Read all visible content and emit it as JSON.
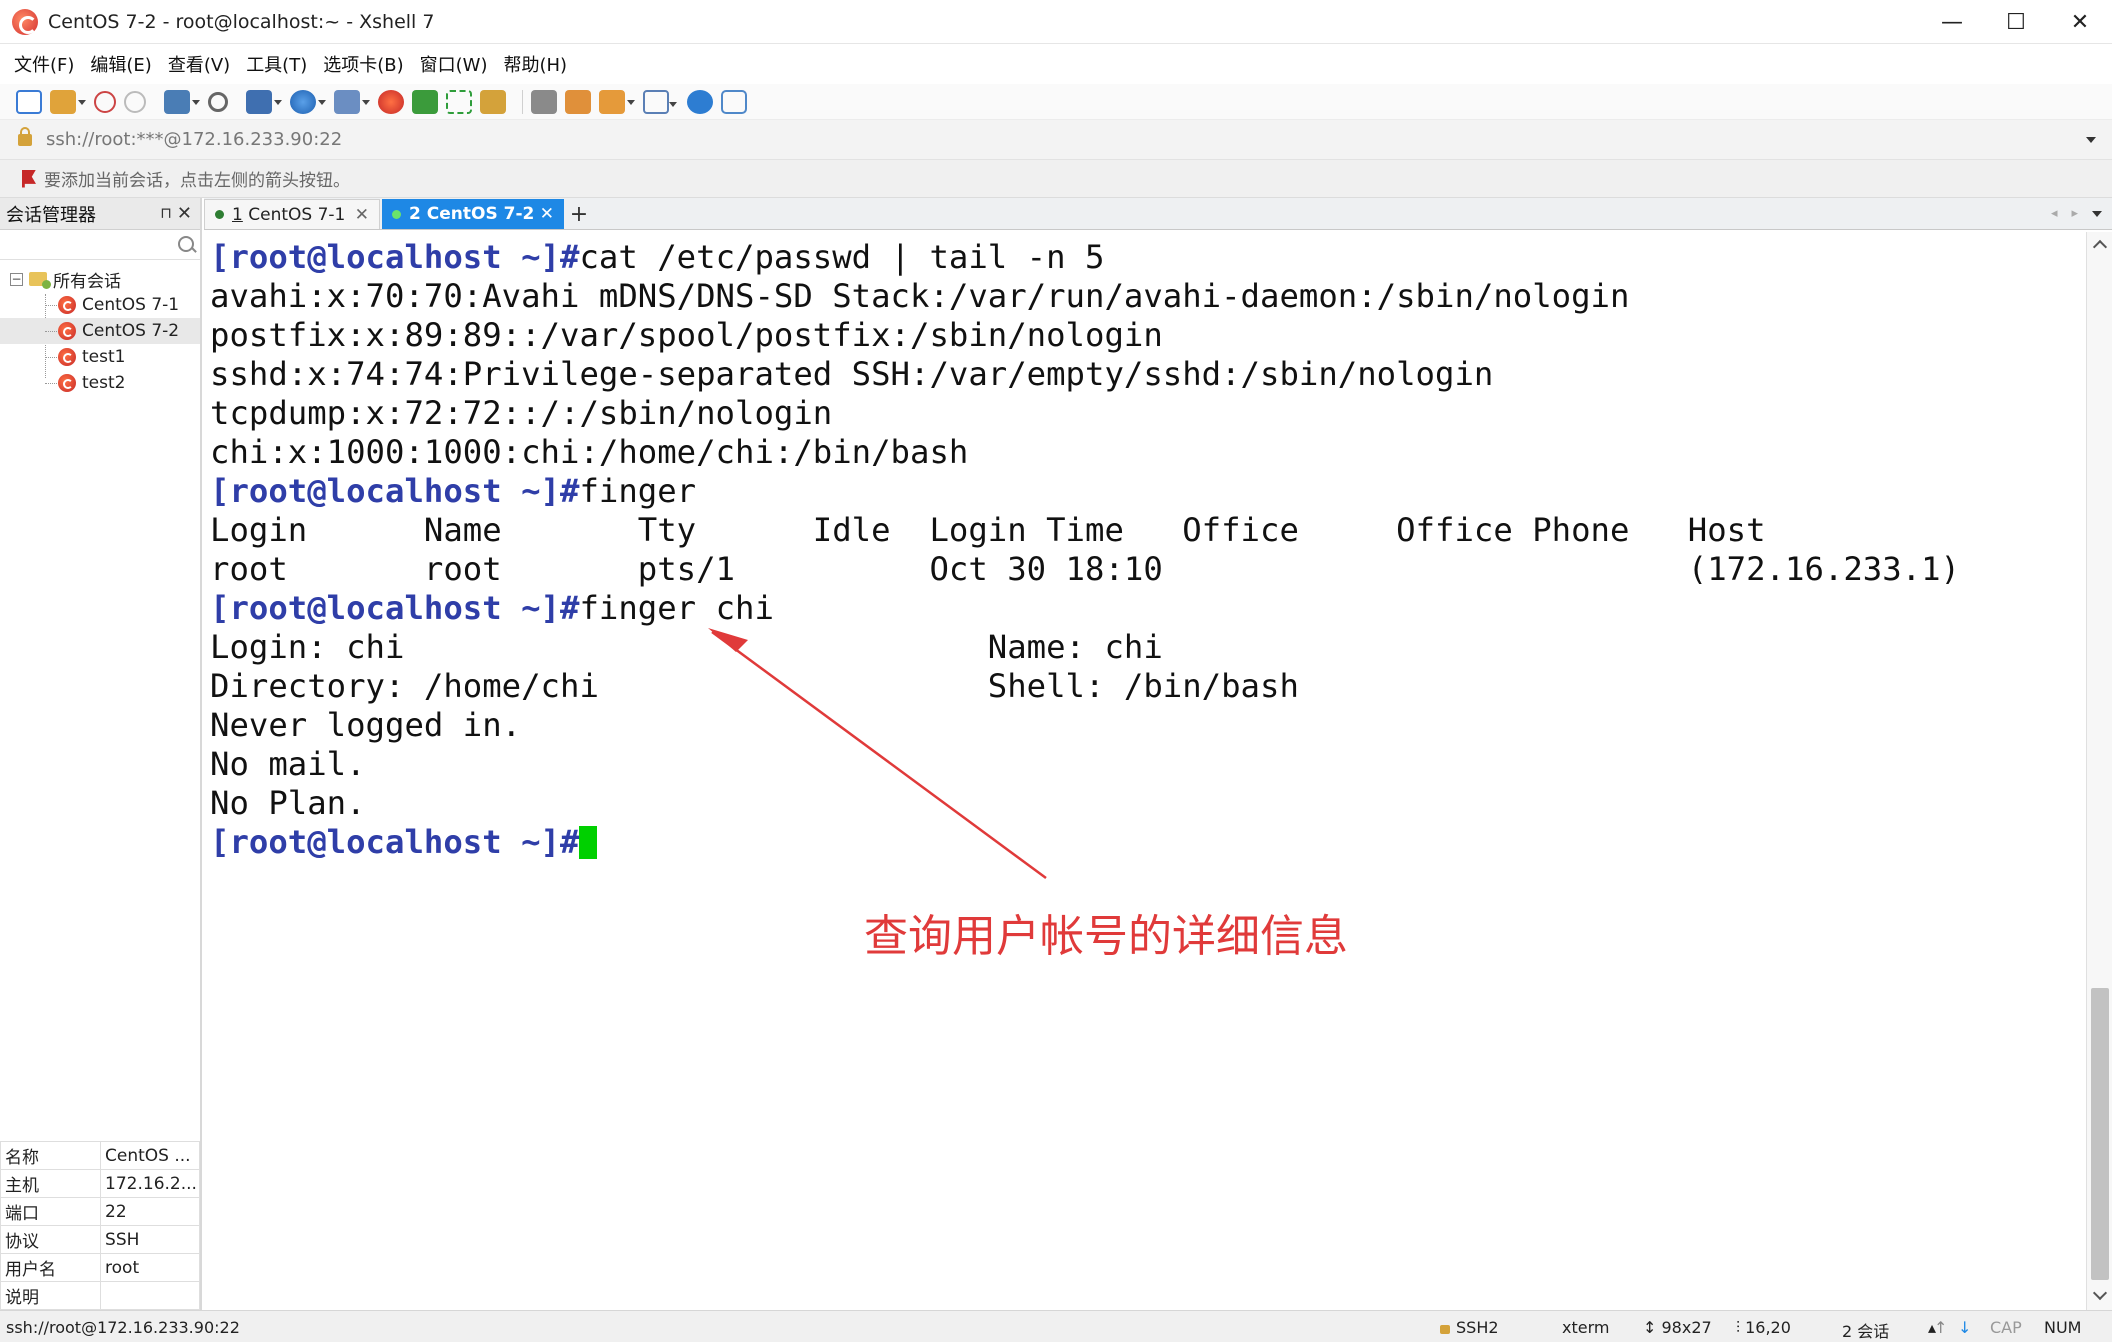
{
  "window": {
    "title": "CentOS 7-2 - root@localhost:~ - Xshell 7",
    "minimize": "—",
    "maximize": "☐",
    "close": "✕"
  },
  "menu": [
    "文件(F)",
    "编辑(E)",
    "查看(V)",
    "工具(T)",
    "选项卡(B)",
    "窗口(W)",
    "帮助(H)"
  ],
  "address": {
    "value": "ssh://root:***@172.16.233.90:22"
  },
  "hint": {
    "text": "要添加当前会话，点击左侧的箭头按钮。"
  },
  "sidebar": {
    "title": "会话管理器",
    "pin": "⊓",
    "close": "✕",
    "search_placeholder": "",
    "tree": {
      "root": "所有会话",
      "expander": "−",
      "items": [
        "CentOS 7-1",
        "CentOS 7-2",
        "test1",
        "test2"
      ]
    },
    "properties": [
      {
        "key": "名称",
        "value": "CentOS ..."
      },
      {
        "key": "主机",
        "value": "172.16.2..."
      },
      {
        "key": "端口",
        "value": "22"
      },
      {
        "key": "协议",
        "value": "SSH"
      },
      {
        "key": "用户名",
        "value": "root"
      },
      {
        "key": "说明",
        "value": ""
      }
    ]
  },
  "tabs": [
    {
      "number": "1",
      "label": "CentOS 7-1",
      "close": "✕"
    },
    {
      "number": "2",
      "label": "CentOS 7-2",
      "close": "✕"
    }
  ],
  "tabbar": {
    "add": "+",
    "prev": "◂",
    "next": "▸"
  },
  "terminal": {
    "lines": [
      {
        "prompt": "[root@localhost ~]#",
        "text": "cat /etc/passwd | tail -n 5"
      },
      {
        "prompt": "",
        "text": "avahi:x:70:70:Avahi mDNS/DNS-SD Stack:/var/run/avahi-daemon:/sbin/nologin"
      },
      {
        "prompt": "",
        "text": "postfix:x:89:89::/var/spool/postfix:/sbin/nologin"
      },
      {
        "prompt": "",
        "text": "sshd:x:74:74:Privilege-separated SSH:/var/empty/sshd:/sbin/nologin"
      },
      {
        "prompt": "",
        "text": "tcpdump:x:72:72::/:/sbin/nologin"
      },
      {
        "prompt": "",
        "text": "chi:x:1000:1000:chi:/home/chi:/bin/bash"
      },
      {
        "prompt": "[root@localhost ~]#",
        "text": "finger"
      },
      {
        "prompt": "",
        "text": "Login      Name       Tty      Idle  Login Time   Office     Office Phone   Host"
      },
      {
        "prompt": "",
        "text": "root       root       pts/1          Oct 30 18:10                           (172.16.233.1)"
      },
      {
        "prompt": "[root@localhost ~]#",
        "text": "finger chi"
      },
      {
        "prompt": "",
        "text": "Login: chi                              Name: chi"
      },
      {
        "prompt": "",
        "text": "Directory: /home/chi                    Shell: /bin/bash"
      },
      {
        "prompt": "",
        "text": "Never logged in."
      },
      {
        "prompt": "",
        "text": "No mail."
      },
      {
        "prompt": "",
        "text": "No Plan."
      },
      {
        "prompt": "[root@localhost ~]#",
        "text": ""
      }
    ]
  },
  "annotation": {
    "text": "查询用户帐号的详细信息",
    "color": "#e03a3a"
  },
  "statusbar": {
    "connection": "ssh://root@172.16.233.90:22",
    "protocol": "SSH2",
    "terminal_type": "xterm",
    "size_icon": "↕",
    "size": "98x27",
    "cursor_icon": "⫶",
    "cursor_pos": "16,20",
    "sessions": "2 会话",
    "up": "↑",
    "down": "↓",
    "cap": "CAP",
    "num": "NUM"
  },
  "colors": {
    "prompt": "#2f3ea8",
    "active_tab": "#1e88e5",
    "cursor": "#00d000"
  }
}
